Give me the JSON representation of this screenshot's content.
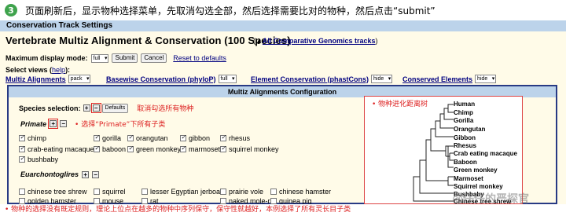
{
  "step": {
    "number": "3",
    "text": "页面刷新后，显示物种选择菜单，先取消勾选全部，然后选择需要比对的物种，然后点击“submit”"
  },
  "header_bar": "Conservation Track Settings",
  "title": "Vertebrate Multiz Alignment & Conservation (100 Species)",
  "title_link": {
    "prefix": "(",
    "arrow": "▲",
    "text": "All Comparative Genomics tracks",
    "suffix": ")"
  },
  "display_mode": {
    "label": "Maximum display mode:",
    "value": "full",
    "submit": "Submit",
    "cancel": "Cancel",
    "reset": "Reset to defaults"
  },
  "select_views": {
    "label": "Select views",
    "help": "help"
  },
  "views": [
    {
      "name": "Multiz Alignments",
      "value": "pack"
    },
    {
      "name": "Basewise Conservation (phyloP)",
      "value": "full"
    },
    {
      "name": "Element Conservation (phastCons)",
      "value": "hide"
    },
    {
      "name": "Conserved Elements",
      "value": "hide"
    }
  ],
  "config": {
    "title": "Multiz Alignments Configuration"
  },
  "species_selection": {
    "label": "Species selection:",
    "plus": "+",
    "minus": "−",
    "defaults": "Defaults",
    "note": "取消勾选所有物种"
  },
  "primate": {
    "label": "Primate",
    "plus": "+",
    "minus": "−",
    "note": "•  选择“Primate”下所有子类"
  },
  "primate_species": [
    {
      "name": "chimp",
      "checked": true
    },
    {
      "name": "gorilla",
      "checked": true
    },
    {
      "name": "orangutan",
      "checked": true
    },
    {
      "name": "gibbon",
      "checked": true
    },
    {
      "name": "rhesus",
      "checked": true
    },
    {
      "name": "crab-eating macaque",
      "checked": true
    },
    {
      "name": "baboon",
      "checked": true
    },
    {
      "name": "green monkey",
      "checked": true
    },
    {
      "name": "marmoset",
      "checked": true
    },
    {
      "name": "squirrel monkey",
      "checked": true
    },
    {
      "name": "bushbaby",
      "checked": true
    }
  ],
  "euarchontoglires": {
    "label": "Euarchontoglires",
    "plus": "+",
    "minus": "−"
  },
  "euarch_species": [
    {
      "name": "chinese tree shrew",
      "checked": false
    },
    {
      "name": "squirrel",
      "checked": false
    },
    {
      "name": "lesser Egyptian jerboa",
      "checked": false
    },
    {
      "name": "prairie vole",
      "checked": false
    },
    {
      "name": "chinese hamster",
      "checked": false
    },
    {
      "name": "golden hamster",
      "checked": false
    },
    {
      "name": "mouse",
      "checked": false
    },
    {
      "name": "rat",
      "checked": false
    },
    {
      "name": "naked mole-rat",
      "checked": false
    },
    {
      "name": "guinea pig",
      "checked": false
    }
  ],
  "tree": {
    "note": "•  物种进化距离树",
    "labels": [
      "Human",
      "Chimp",
      "Gorilla",
      "Orangutan",
      "Gibbon",
      "Rhesus",
      "Crab eating macaque",
      "Baboon",
      "Green monkey",
      "Marmoset",
      "Squirrel monkey",
      "Bushbaby",
      "Chinese tree shrew"
    ]
  },
  "footnote": "•  物种的选择没有既定规则，理论上位点在越多的物种中序列保守，保守性就越好，本例选择了所有灵长目子类",
  "watermark": "@仔仔的严探官"
}
